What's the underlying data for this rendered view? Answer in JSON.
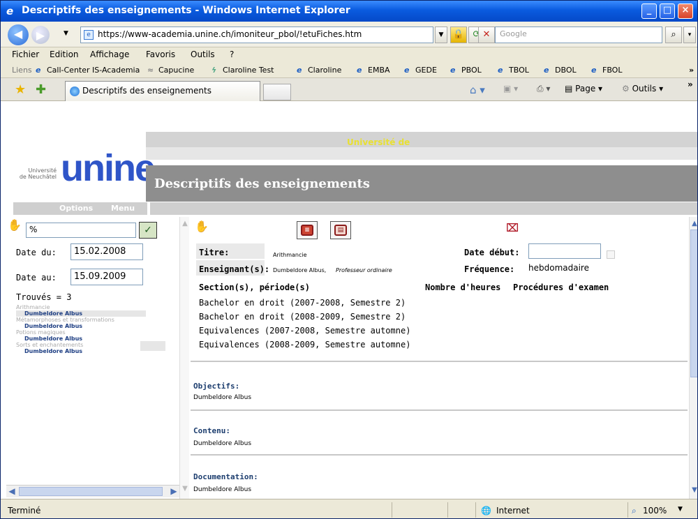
{
  "window": {
    "title": "Descriptifs des enseignements - Windows Internet Explorer",
    "min": "_",
    "max": "□",
    "close": "×"
  },
  "address_bar": {
    "url": "https://www-academia.unine.ch/imoniteur_pbol/!etuFiches.htm",
    "search_placeholder": "Google"
  },
  "menu": [
    "Fichier",
    "Edition",
    "Affichage",
    "Favoris",
    "Outils",
    "?"
  ],
  "links_bar": {
    "label": "Liens",
    "items": [
      "Call-Center IS-Academia",
      "Capucine",
      "Claroline Test",
      "Claroline",
      "EMBA",
      "GEDE",
      "PBOL",
      "TBOL",
      "DBOL",
      "FBOL"
    ]
  },
  "tab": {
    "title": "Descriptifs des enseignements",
    "page_menu": "Page",
    "tools_menu": "Outils"
  },
  "header": {
    "university_text": "Université de",
    "logo_small": "Université\nde Neuchâtel",
    "logo_big": "unine",
    "page_title": "Descriptifs des enseignements",
    "options": "Options",
    "menu": "Menu"
  },
  "left_panel": {
    "filter_value": "%",
    "date_from_label": "Date du:",
    "date_from": "15.02.2008",
    "date_to_label": "Date au:",
    "date_to": "15.09.2009",
    "found": "Trouvés = 3",
    "results": [
      {
        "category": "Arithmancie",
        "name": "Dumbeldore Albus"
      },
      {
        "category": "Métamorphoses et transformations",
        "name": "Dumbeldore Albus"
      },
      {
        "category": "Potions magiques",
        "name": "Dumbeldore Albus"
      },
      {
        "category": "Sorts et enchantements",
        "name": "Dumbeldore Albus"
      }
    ]
  },
  "detail": {
    "titre_label": "Titre:",
    "titre_value": "Arithmancie",
    "enseignant_label": "Enseignant(s):",
    "enseignant_name": "Dumbeldore Albus,",
    "enseignant_role": "Professeur ordinaire",
    "date_debut_label": "Date début:",
    "frequence_label": "Fréquence:",
    "frequence_value": "hebdomadaire",
    "col_section": "Section(s), période(s)",
    "col_heures": "Nombre d'heures",
    "col_examens": "Procédures d'examen",
    "sections": [
      "Bachelor en droit (2007-2008, Semestre 2)",
      "Bachelor en droit (2008-2009, Semestre 2)",
      "Equivalences (2007-2008, Semestre automne)",
      "Equivalences (2008-2009, Semestre automne)"
    ],
    "objectifs_label": "Objectifs:",
    "objectifs_value": "Dumbeldore Albus",
    "contenu_label": "Contenu:",
    "contenu_value": "Dumbeldore Albus",
    "documentation_label": "Documentation:",
    "documentation_value": "Dumbeldore Albus"
  },
  "status_bar": {
    "status": "Terminé",
    "zone": "Internet",
    "zoom": "100%"
  }
}
